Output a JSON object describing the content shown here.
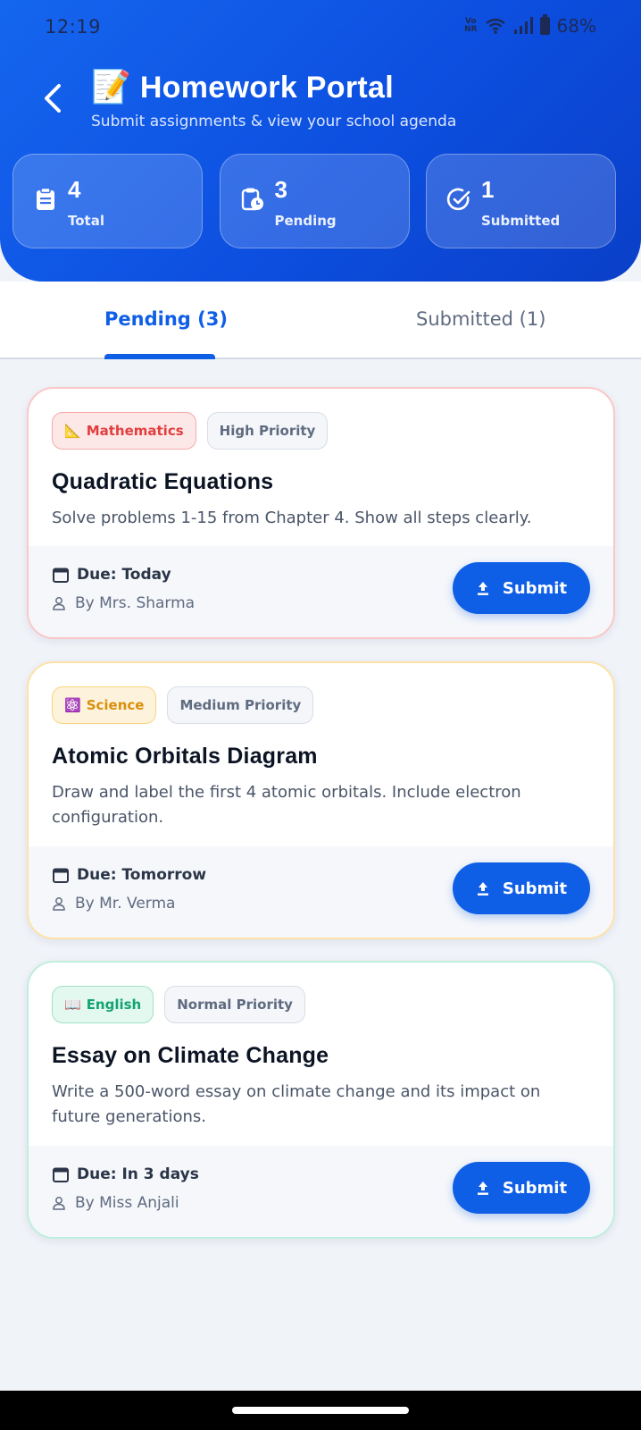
{
  "status_bar": {
    "time": "12:19",
    "battery": "68%",
    "volte": "Vo\nNR"
  },
  "header": {
    "title_emoji": "📝",
    "title": "Homework Portal",
    "subtitle": "Submit assignments & view your school agenda"
  },
  "stats": [
    {
      "value": "4",
      "label": "Total",
      "icon": "clipboard-list-icon"
    },
    {
      "value": "3",
      "label": "Pending",
      "icon": "clipboard-clock-icon"
    },
    {
      "value": "1",
      "label": "Submitted",
      "icon": "check-circle-icon"
    }
  ],
  "tabs": {
    "pending": "Pending (3)",
    "submitted": "Submitted (1)",
    "active": "pending"
  },
  "assignments": [
    {
      "subject_emoji": "📐",
      "subject": "Mathematics",
      "priority": "High Priority",
      "title": "Quadratic Equations",
      "description": "Solve problems 1-15 from Chapter 4. Show all steps clearly.",
      "due": "Due: Today",
      "teacher": "By Mrs. Sharma",
      "action": "Submit",
      "accent": "#e23e3e"
    },
    {
      "subject_emoji": "⚛️",
      "subject": "Science",
      "priority": "Medium Priority",
      "title": "Atomic Orbitals Diagram",
      "description": "Draw and label the first 4 atomic orbitals. Include electron configuration.",
      "due": "Due: Tomorrow",
      "teacher": "By Mr. Verma",
      "action": "Submit",
      "accent": "#d98f0a"
    },
    {
      "subject_emoji": "📖",
      "subject": "English",
      "priority": "Normal Priority",
      "title": "Essay on Climate Change",
      "description": "Write a 500-word essay on climate change and its impact on future generations.",
      "due": "Due: In 3 days",
      "teacher": "By Miss Anjali",
      "action": "Submit",
      "accent": "#14a373"
    }
  ],
  "colors": {
    "primary": "#0f5fe6",
    "header_gradient_start": "#1566ef",
    "header_gradient_end": "#0a3fc8",
    "background": "#f0f3f8"
  }
}
